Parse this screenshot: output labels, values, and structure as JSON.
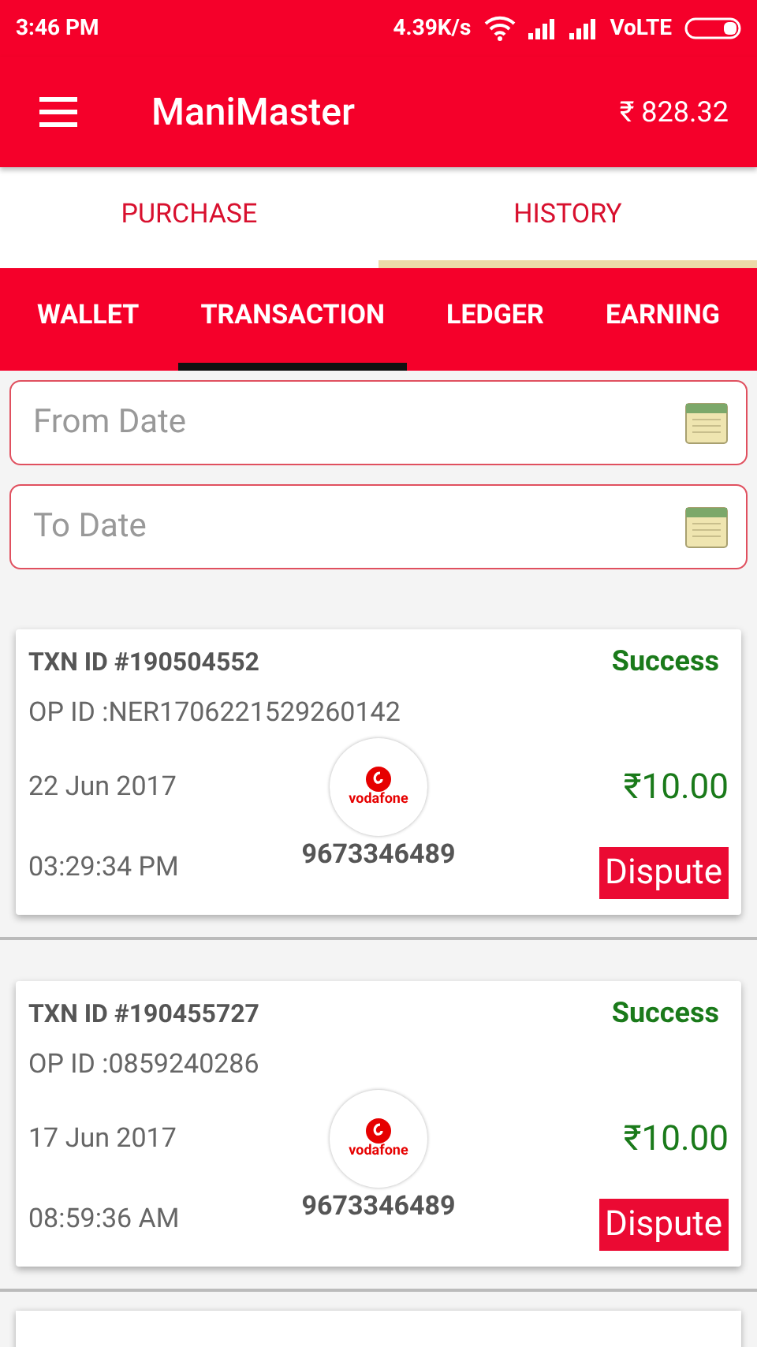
{
  "status_bar": {
    "time": "3:46 PM",
    "speed": "4.39K/s",
    "network": "VoLTE"
  },
  "app_bar": {
    "title": "ManiMaster",
    "balance": "₹ 828.32"
  },
  "main_tabs": [
    {
      "label": "PURCHASE",
      "selected": false
    },
    {
      "label": "HISTORY",
      "selected": true
    }
  ],
  "sub_tabs": [
    {
      "label": "WALLET",
      "selected": false
    },
    {
      "label": "TRANSACTION",
      "selected": true
    },
    {
      "label": "LEDGER",
      "selected": false
    },
    {
      "label": "EARNING",
      "selected": false
    }
  ],
  "filters": [
    {
      "placeholder": "From Date"
    },
    {
      "placeholder": "To Date"
    }
  ],
  "transactions": [
    {
      "txn_id": "TXN ID #190504552",
      "status": "Success",
      "op_id": "OP ID :NER1706221529260142",
      "date": "22 Jun 2017",
      "time": "03:29:34 PM",
      "operator_logo": "vodafone",
      "number": "9673346489",
      "amount": "₹10.00",
      "action": "Dispute"
    },
    {
      "txn_id": "TXN ID #190455727",
      "status": "Success",
      "op_id": "OP ID :0859240286",
      "date": "17 Jun 2017",
      "time": "08:59:36 AM",
      "operator_logo": "vodafone",
      "number": "9673346489",
      "amount": "₹10.00",
      "action": "Dispute"
    }
  ]
}
